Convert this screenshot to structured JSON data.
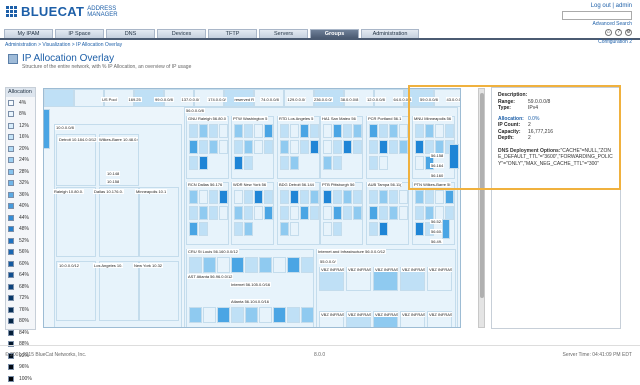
{
  "brand": {
    "name": "BLUECAT",
    "sub1": "ADDRESS",
    "sub2": "MANAGER"
  },
  "top": {
    "logout": "Log out",
    "user": "admin",
    "advanced": "Advanced Search"
  },
  "tabs": [
    "My IPAM",
    "IP Space",
    "DNS",
    "Devices",
    "TFTP",
    "Servers",
    "Groups",
    "Administration"
  ],
  "selected_tab": "Groups",
  "breadcrumb": "Administration > Visualization > IP Allocation Overlay",
  "config": "Configuration 2",
  "title": "IP Allocation Overlay",
  "subtitle": "Structure of the entire network, with % IP Allocation, an overview of IP usage",
  "legend": {
    "header": "Allocation",
    "items": [
      "4%",
      "8%",
      "12%",
      "16%",
      "20%",
      "24%",
      "28%",
      "32%",
      "36%",
      "40%",
      "44%",
      "48%",
      "52%",
      "56%",
      "60%",
      "64%",
      "68%",
      "72%",
      "76%",
      "80%",
      "84%",
      "88%",
      "92%",
      "96%",
      "100%"
    ]
  },
  "map": {
    "top_labels": [
      "US Pool",
      "169.25",
      "99.0.0.0/8",
      "137.0.0.0/",
      "174.0.0.0/",
      "reserved R",
      "74.0.0.0/8",
      "129.0.0.0/",
      "236.0.0.0/",
      "38.0.0.0/8",
      "12.0.0.0/8",
      "64.0.0.0/8",
      "59.0.0.0/8",
      "43.0.0.0/8"
    ],
    "blocks": {
      "b10": "10.0.0.0/8",
      "b56": "56.0.0.0/8",
      "b55": "55.0.0.0/"
    },
    "sites": [
      "Detroit 10.184.0.0/12",
      "Wilkes-Barre 10.48.0.0",
      "Raleigh 10.80.0.",
      "Dallas 10.176.0.",
      "Minneapolis 10.1",
      "Los Angeles 10.",
      "New York 10.32",
      "GNU Raleigh 56.80.0",
      "PTW Washington 5",
      "RTD Los Angeles 5",
      "HA1 San Mateo 56",
      "PCR Portland 56.1",
      "MNU Minneapolis 56",
      "RCN Dallas 56.176",
      "WDR New York 56",
      "BDG Detroit 56.144",
      "PTB Pittsburgh 56",
      "AUB Tampa 56.11(",
      "PTN Wilkes-Barre 5I",
      "CRU St Louis 56.160.0.0/12",
      "AST Atlanta 56.96.0.0/12",
      "Internet and Infrastructure 56.0.0.0/12",
      "Internet 56.105.0.0/16",
      "Atlanta 56.104.0.0/16",
      "VBZ INFRASTRU",
      "VBZ INFRASTF"
    ],
    "small": [
      "10.148",
      "10.158",
      "56.158",
      "56.164",
      "56.160",
      "56.52.",
      "56.60.",
      "56.49."
    ],
    "bottom": [
      "10.0.0.0/12"
    ]
  },
  "panel": {
    "description_label": "Description:",
    "range_label": "Range:",
    "range": "59.0.0.0/8",
    "type_label": "Type:",
    "type": "IPv4",
    "allocation_label": "Allocation:",
    "allocation": "0.0%",
    "ipcount_label": "IP Count:",
    "ipcount": "2",
    "capacity_label": "Capacity:",
    "capacity": "16,777,216",
    "depth_label": "Depth:",
    "depth": "2",
    "dns_label": "DNS Deployment Options:",
    "dns_value": "\"CACHE\"=NULL,\"ZONE_DEFAULT_TTL\"=\"3600\",\"FORWARDING_POLICY\"=\"ONLY\",\"MAX_NEG_CACHE_TTL\"=\"300\""
  },
  "footer": {
    "copyright": "© 2001-2015 BlueCat Networks, Inc.",
    "version": "8.0.0",
    "time": "Server Time: 04:41:09 PM EDT"
  }
}
